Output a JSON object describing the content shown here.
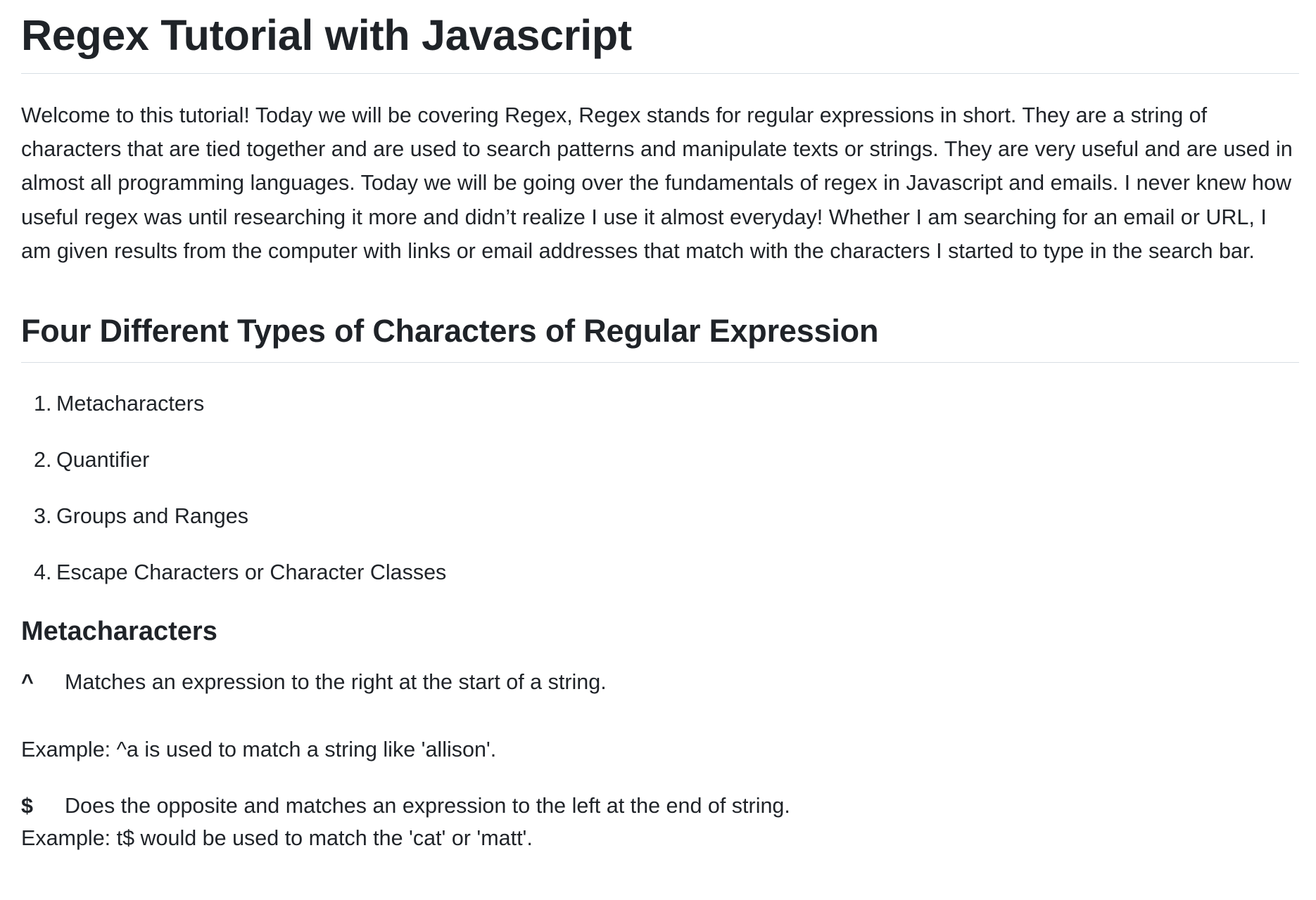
{
  "document": {
    "title": "Regex Tutorial with Javascript",
    "intro": "Welcome to this tutorial! Today we will be covering Regex, Regex stands for regular expressions in short. They are a string of characters that are tied together and are used to search patterns and manipulate texts or strings. They are very useful and are used in almost all programming languages. Today we will be going over the fundamentals of regex in Javascript and emails. I never knew how useful regex was until researching it more and didn’t realize I use it almost everyday! Whether I am searching for an email or URL, I am given results from the computer with links or email addresses that match with the characters I started to type in the search bar.",
    "section_title": "Four Different Types of Characters of Regular Expression",
    "types": [
      {
        "num": "1.",
        "label": "Metacharacters"
      },
      {
        "num": "2.",
        "label": "Quantifier"
      },
      {
        "num": "3.",
        "label": "Groups and Ranges"
      },
      {
        "num": "4.",
        "label": "Escape Characters or Character Classes"
      }
    ],
    "metacharacters": {
      "title": "Metacharacters",
      "items": [
        {
          "symbol": "^",
          "description": "Matches an expression to the right at the start of a string.",
          "example": "Example: ^a is used to match a string like 'allison'."
        },
        {
          "symbol": "$",
          "description": "Does the opposite and matches an expression to the left at the end of string.",
          "example": "Example: t$ would be used to match the 'cat' or 'matt'."
        }
      ]
    }
  }
}
